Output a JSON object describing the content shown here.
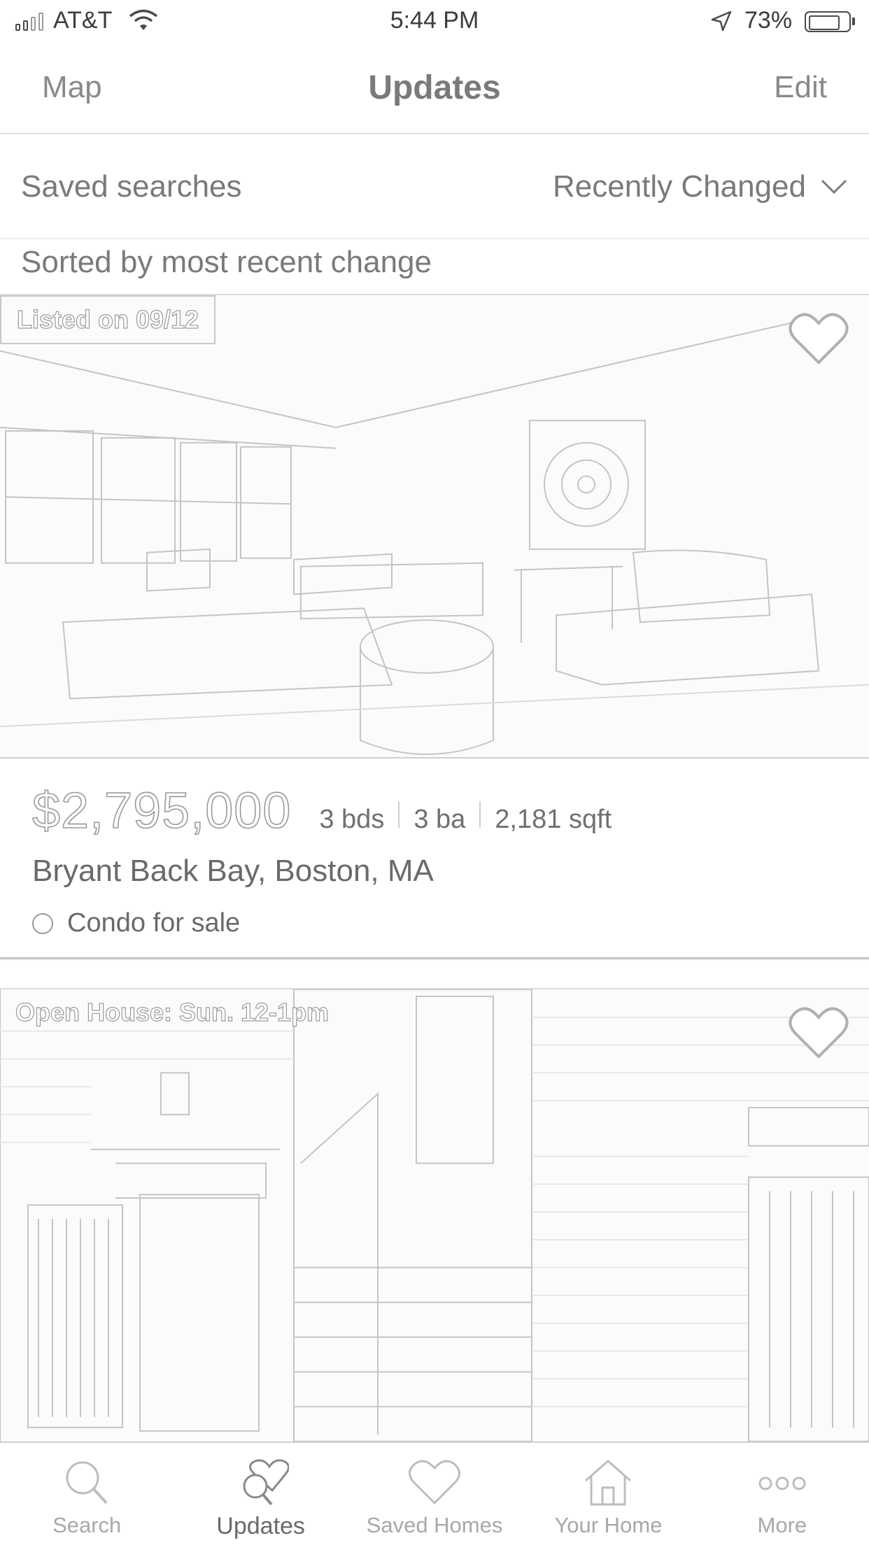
{
  "status_bar": {
    "carrier": "AT&T",
    "time": "5:44 PM",
    "battery": "73%"
  },
  "nav": {
    "left": "Map",
    "title": "Updates",
    "right": "Edit"
  },
  "filter": {
    "saved_searches": "Saved searches",
    "sort_selected": "Recently Changed",
    "caption": "Sorted by most recent change"
  },
  "listings": [
    {
      "badge": "Listed on 09/12",
      "price": "$2,795,000",
      "beds": "3 bds",
      "baths": "3 ba",
      "sqft": "2,181 sqft",
      "address": "Bryant Back Bay, Boston, MA",
      "status": "Condo for sale"
    },
    {
      "badge": "Open House: Sun. 12-1pm"
    }
  ],
  "tabs": [
    {
      "label": "Search",
      "icon": "search-icon"
    },
    {
      "label": "Updates",
      "icon": "updates-icon",
      "active": true
    },
    {
      "label": "Saved Homes",
      "icon": "heart-icon"
    },
    {
      "label": "Your Home",
      "icon": "house-icon"
    },
    {
      "label": "More",
      "icon": "more-icon"
    }
  ]
}
